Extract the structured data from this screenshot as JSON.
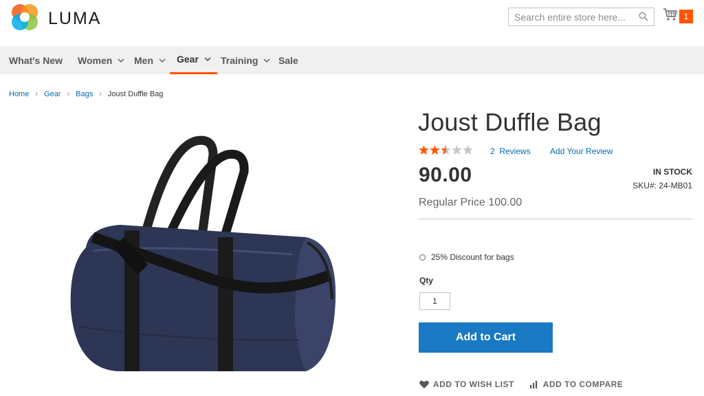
{
  "header": {
    "logo_text": "LUMA",
    "search": {
      "placeholder": "Search entire store here...",
      "value": ""
    },
    "cart_count": "1"
  },
  "nav": {
    "items": [
      {
        "label": "What's New",
        "has_dropdown": false,
        "active": false
      },
      {
        "label": "Women",
        "has_dropdown": true,
        "active": false
      },
      {
        "label": "Men",
        "has_dropdown": true,
        "active": false
      },
      {
        "label": "Gear",
        "has_dropdown": true,
        "active": true
      },
      {
        "label": "Training",
        "has_dropdown": true,
        "active": false
      },
      {
        "label": "Sale",
        "has_dropdown": false,
        "active": false
      }
    ]
  },
  "breadcrumb": {
    "items": [
      "Home",
      "Gear",
      "Bags"
    ],
    "current": "Joust Duffle Bag"
  },
  "product": {
    "title": "Joust Duffle Bag",
    "rating_stars": 2.5,
    "rating_max": 5,
    "reviews_label": "2  Reviews",
    "add_review_label": "Add Your Review",
    "price": "90.00",
    "stock": "IN STOCK",
    "sku_label": "SKU#:",
    "sku": "24-MB01",
    "regular_price": "Regular Price 100.00",
    "option_label": "25% Discount for bags",
    "qty_label": "Qty",
    "qty_value": "1",
    "add_to_cart_label": "Add to Cart",
    "wishlist_label": "ADD TO WISH LIST",
    "compare_label": "ADD TO COMPARE"
  },
  "colors": {
    "accent": "#ff5501",
    "link": "#006bb4",
    "primary_button": "#1979c3",
    "nav_bg": "#f0f0f0"
  },
  "icons": {
    "logo": "luma-logo-icon",
    "search": "search-icon",
    "cart": "cart-icon",
    "wishlist": "heart-icon",
    "compare": "bar-chart-icon"
  }
}
